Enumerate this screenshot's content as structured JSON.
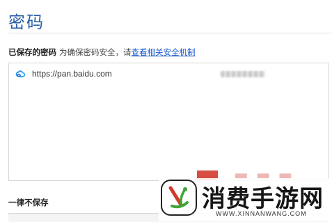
{
  "page": {
    "title": "密码"
  },
  "saved": {
    "heading": "已保存的密码",
    "hint": "为确保密码安全，请",
    "link": "查看相关安全机制",
    "items": [
      {
        "url": "https://pan.baidu.com",
        "icon": "baidu-cloud-icon"
      }
    ]
  },
  "never_saved": {
    "heading": "一律不保存"
  },
  "watermark": {
    "text": "消费手游网",
    "url": "WWW.XINNANWANG.COM",
    "icon": "brand-logo-icon",
    "colors": {
      "red": "#d23a2c",
      "green": "#3fa535"
    }
  },
  "colors": {
    "title": "#2a5fa8",
    "link": "#1a59c8"
  }
}
